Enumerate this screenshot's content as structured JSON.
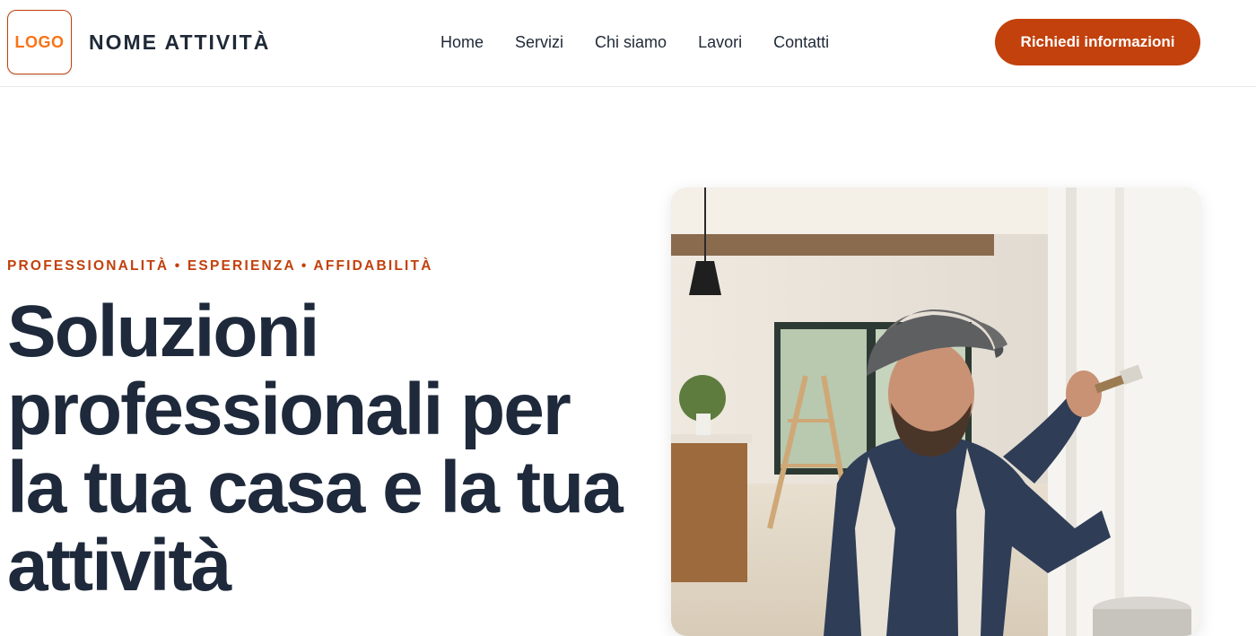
{
  "header": {
    "logo_text": "LOGO",
    "brand_name": "NOME ATTIVITÀ",
    "nav": [
      "Home",
      "Servizi",
      "Chi siamo",
      "Lavori",
      "Contatti"
    ],
    "cta_label": "Richiedi informazioni"
  },
  "hero": {
    "tagline": "PROFESSIONALITÀ • ESPERIENZA • AFFIDABILITÀ",
    "headline": "Soluzioni professionali per la tua casa e la tua attività",
    "image_subject": "painter-working-photo"
  },
  "colors": {
    "accent": "#c2410c",
    "logo_text": "#f97316",
    "heading": "#1e293b",
    "border": "#e5e7eb"
  }
}
